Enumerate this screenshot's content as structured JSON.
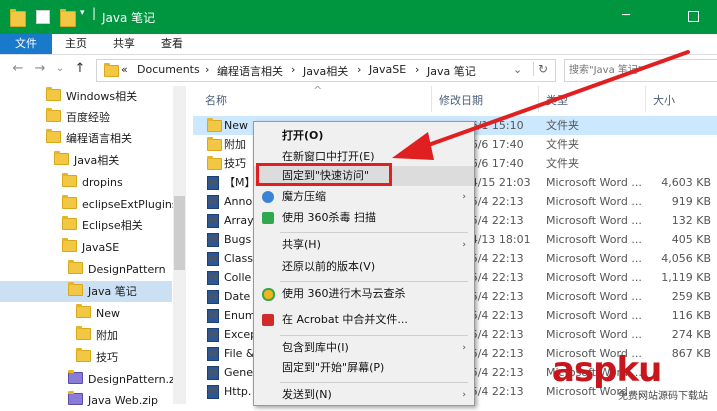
{
  "window": {
    "title": "Java 笔记",
    "minimize": "─",
    "maximize": "☐",
    "close": "✕"
  },
  "ribbon": {
    "tabs": [
      "文件",
      "主页",
      "共享",
      "查看"
    ]
  },
  "nav": {
    "back": "←",
    "forward": "→",
    "recent": "⌄",
    "up": "↑"
  },
  "address": {
    "prefix": "«",
    "segments": [
      "Documents",
      "编程语言相关",
      "Java相关",
      "JavaSE",
      "Java 笔记"
    ],
    "separator": "›",
    "dropdown": "⌄",
    "refresh": "↻"
  },
  "search": {
    "placeholder": "搜索\"Java 笔记\""
  },
  "nav_pane": {
    "items": [
      {
        "label": "Windows相关"
      },
      {
        "label": "百度经验"
      },
      {
        "label": "编程语言相关"
      },
      {
        "label": "Java相关"
      },
      {
        "label": "dropins"
      },
      {
        "label": "eclipseExtPlugins"
      },
      {
        "label": "Eclipse相关"
      },
      {
        "label": "JavaSE"
      },
      {
        "label": "DesignPattern"
      },
      {
        "label": "Java 笔记"
      },
      {
        "label": "New"
      },
      {
        "label": "附加"
      },
      {
        "label": "技巧"
      },
      {
        "label": "DesignPattern.zip"
      },
      {
        "label": "Java Web.zip"
      }
    ]
  },
  "file_list": {
    "columns": {
      "name": "名称",
      "modified": "修改日期",
      "type": "类型",
      "size": "大小"
    },
    "sort_indicator": "^",
    "rows": [
      {
        "name": "New",
        "modified": "2016/6/1 15:10",
        "type": "文件夹",
        "size": "",
        "icon": "folder-icon"
      },
      {
        "name": "附加",
        "modified": "2016/6/6 17:40",
        "type": "文件夹",
        "size": "",
        "icon": "folder-icon"
      },
      {
        "name": "技巧",
        "modified": "2016/6/6 17:40",
        "type": "文件夹",
        "size": "",
        "icon": "folder-icon"
      },
      {
        "name": "【M】",
        "modified": "2016/4/15 21:03",
        "type": "Microsoft Word ...",
        "size": "4,603 KB",
        "icon": "word-icon"
      },
      {
        "name": "Anno",
        "modified": "2016/5/4 22:13",
        "type": "Microsoft Word ...",
        "size": "919 KB",
        "icon": "word-icon"
      },
      {
        "name": "Array",
        "modified": "2016/5/4 22:13",
        "type": "Microsoft Word ...",
        "size": "132 KB",
        "icon": "word-icon"
      },
      {
        "name": "Bugs",
        "modified": "2016/4/13 18:01",
        "type": "Microsoft Word ...",
        "size": "405 KB",
        "icon": "word-icon"
      },
      {
        "name": "Class",
        "modified": "2016/5/4 22:13",
        "type": "Microsoft Word ...",
        "size": "4,056 KB",
        "icon": "word-icon"
      },
      {
        "name": "Colle",
        "modified": "2016/5/4 22:13",
        "type": "Microsoft Word ...",
        "size": "1,119 KB",
        "icon": "word-icon"
      },
      {
        "name": "Date",
        "modified": "2016/5/4 22:13",
        "type": "Microsoft Word ...",
        "size": "259 KB",
        "icon": "word-icon"
      },
      {
        "name": "Enum",
        "modified": "2016/5/4 22:13",
        "type": "Microsoft Word ...",
        "size": "116 KB",
        "icon": "word-icon"
      },
      {
        "name": "Excep",
        "modified": "2016/5/4 22:13",
        "type": "Microsoft Word ...",
        "size": "274 KB",
        "icon": "word-icon"
      },
      {
        "name": "File &",
        "modified": "2016/5/4 22:13",
        "type": "Microsoft Word ...",
        "size": "867 KB",
        "icon": "word-icon"
      },
      {
        "name": "Gene",
        "modified": "2016/5/4 22:13",
        "type": "Microsoft Word ...",
        "size": "",
        "icon": "word-icon"
      },
      {
        "name": "Http.",
        "modified": "2016/5/4 22:13",
        "type": "Microsoft Word ...",
        "size": "",
        "icon": "word-icon"
      }
    ]
  },
  "context_menu": {
    "items": [
      {
        "label": "打开(O)",
        "bold": true
      },
      {
        "label": "在新窗口中打开(E)"
      },
      {
        "label": "固定到\"快速访问\"",
        "highlighted": true
      },
      {
        "label": "魔方压缩",
        "submenu": "›"
      },
      {
        "label": "使用 360杀毒 扫描"
      },
      {
        "label": "共享(H)",
        "submenu": "›"
      },
      {
        "label": "还原以前的版本(V)"
      },
      {
        "label": "使用 360进行木马云查杀"
      },
      {
        "label": "在 Acrobat 中合并文件..."
      },
      {
        "label": "包含到库中(I)",
        "submenu": "›"
      },
      {
        "label": "固定到\"开始\"屏幕(P)"
      },
      {
        "label": "发送到(N)",
        "submenu": "›"
      }
    ]
  },
  "watermark": {
    "logo": "aspku",
    "sub": "免费网站源码下载站"
  },
  "colors": {
    "titlebar": "#009640",
    "file_tab": "#1979ca",
    "highlight": "#e02020",
    "arrow": "#e02020"
  }
}
